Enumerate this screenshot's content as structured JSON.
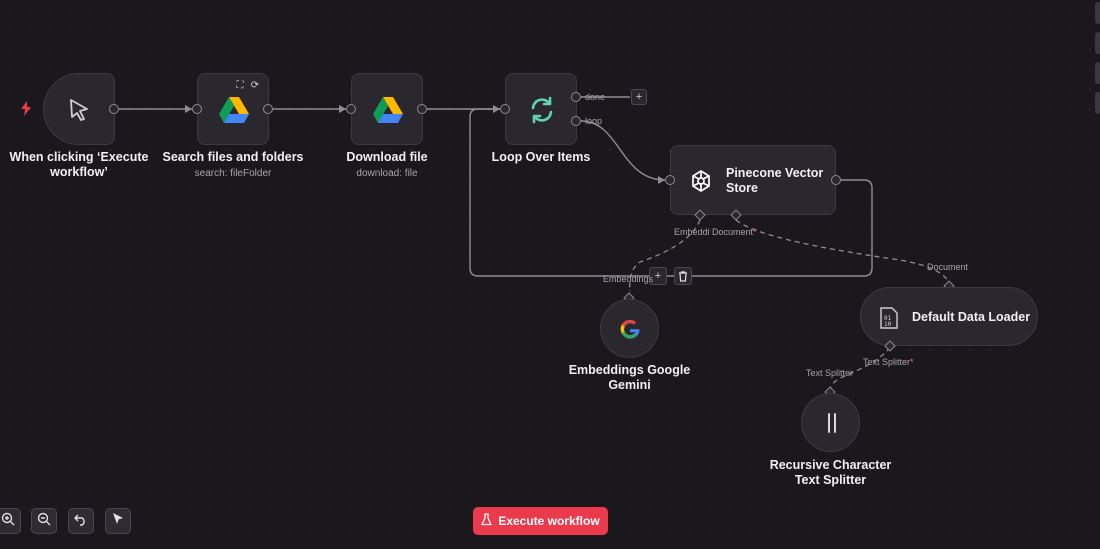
{
  "colors": {
    "background": "#1a181d",
    "node": "#2a282e",
    "accent_red": "#ea3a4b",
    "loop_green": "#5fd1b4"
  },
  "nodes": {
    "trigger": {
      "label": "When clicking ‘Execute workflow’",
      "icon": "cursor-icon"
    },
    "search": {
      "label": "Search files and folders",
      "sub": "search: fileFolder",
      "icon": "google-drive-icon"
    },
    "download": {
      "label": "Download file",
      "sub": "download: file",
      "icon": "google-drive-icon"
    },
    "loop": {
      "label": "Loop Over Items",
      "icon": "loop-icon",
      "out_done": "done",
      "out_loop": "loop"
    },
    "pinecone": {
      "label": "Pinecone Vector Store",
      "icon": "pinecone-icon",
      "in_embedding": "Embeddi",
      "in_document": "Document",
      "required_mark": "*"
    },
    "embeddings": {
      "label": "Embeddings Google Gemini",
      "icon": "google-icon",
      "conn": "Embeddings"
    },
    "loader": {
      "label": "Default Data Loader",
      "icon": "binary-file-icon",
      "conn": "Document",
      "in_splitter": "Text Splitter",
      "required_mark": "*"
    },
    "splitter": {
      "label": "Recursive Character Text Splitter",
      "icon": "splitter-icon",
      "conn": "Text Splitter"
    }
  },
  "toolbar": {
    "execute_label": "Execute workflow"
  },
  "controls": [
    "zoom-in-icon",
    "zoom-out-icon",
    "undo-icon",
    "pointer-icon"
  ],
  "node_actions": {
    "add": "+",
    "delete": "trash-icon"
  }
}
